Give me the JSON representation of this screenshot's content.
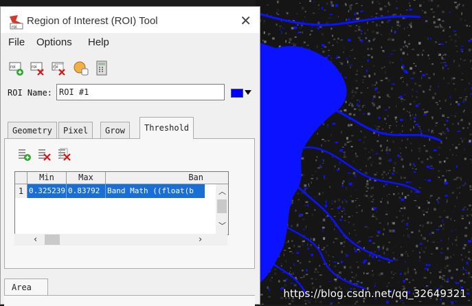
{
  "window": {
    "title": "Region of Interest (ROI) Tool",
    "close_glyph": "✕",
    "app_icon": "roi-app-icon"
  },
  "menu": [
    "File",
    "Options",
    "Help"
  ],
  "toolbar": {
    "icons": [
      "roi-new-icon",
      "roi-delete-icon",
      "roi-delete-all-icon",
      "roi-hand-icon",
      "calculator-icon"
    ]
  },
  "roi": {
    "label": "ROI Name:",
    "value": "ROI #1",
    "color": "#0000ff"
  },
  "tabs": [
    {
      "label": "Geometry",
      "active": false
    },
    {
      "label": "Pixel",
      "active": false
    },
    {
      "label": "Grow",
      "active": false
    },
    {
      "label": "Threshold",
      "active": true
    }
  ],
  "threshold": {
    "tool_icons": [
      "threshold-add-icon",
      "threshold-delete-icon",
      "threshold-delete-all-icon"
    ],
    "columns": [
      "Min",
      "Max",
      "Ban"
    ],
    "rows": [
      {
        "index": "1",
        "min": "0.325239",
        "max": "0.83792",
        "band": "Band Math ((float(b"
      }
    ]
  },
  "area_tab": {
    "label": "Area"
  },
  "image": {
    "watermark": "https://blog.csdn.net/qq_32649321",
    "water_color": "#0a12ff"
  }
}
